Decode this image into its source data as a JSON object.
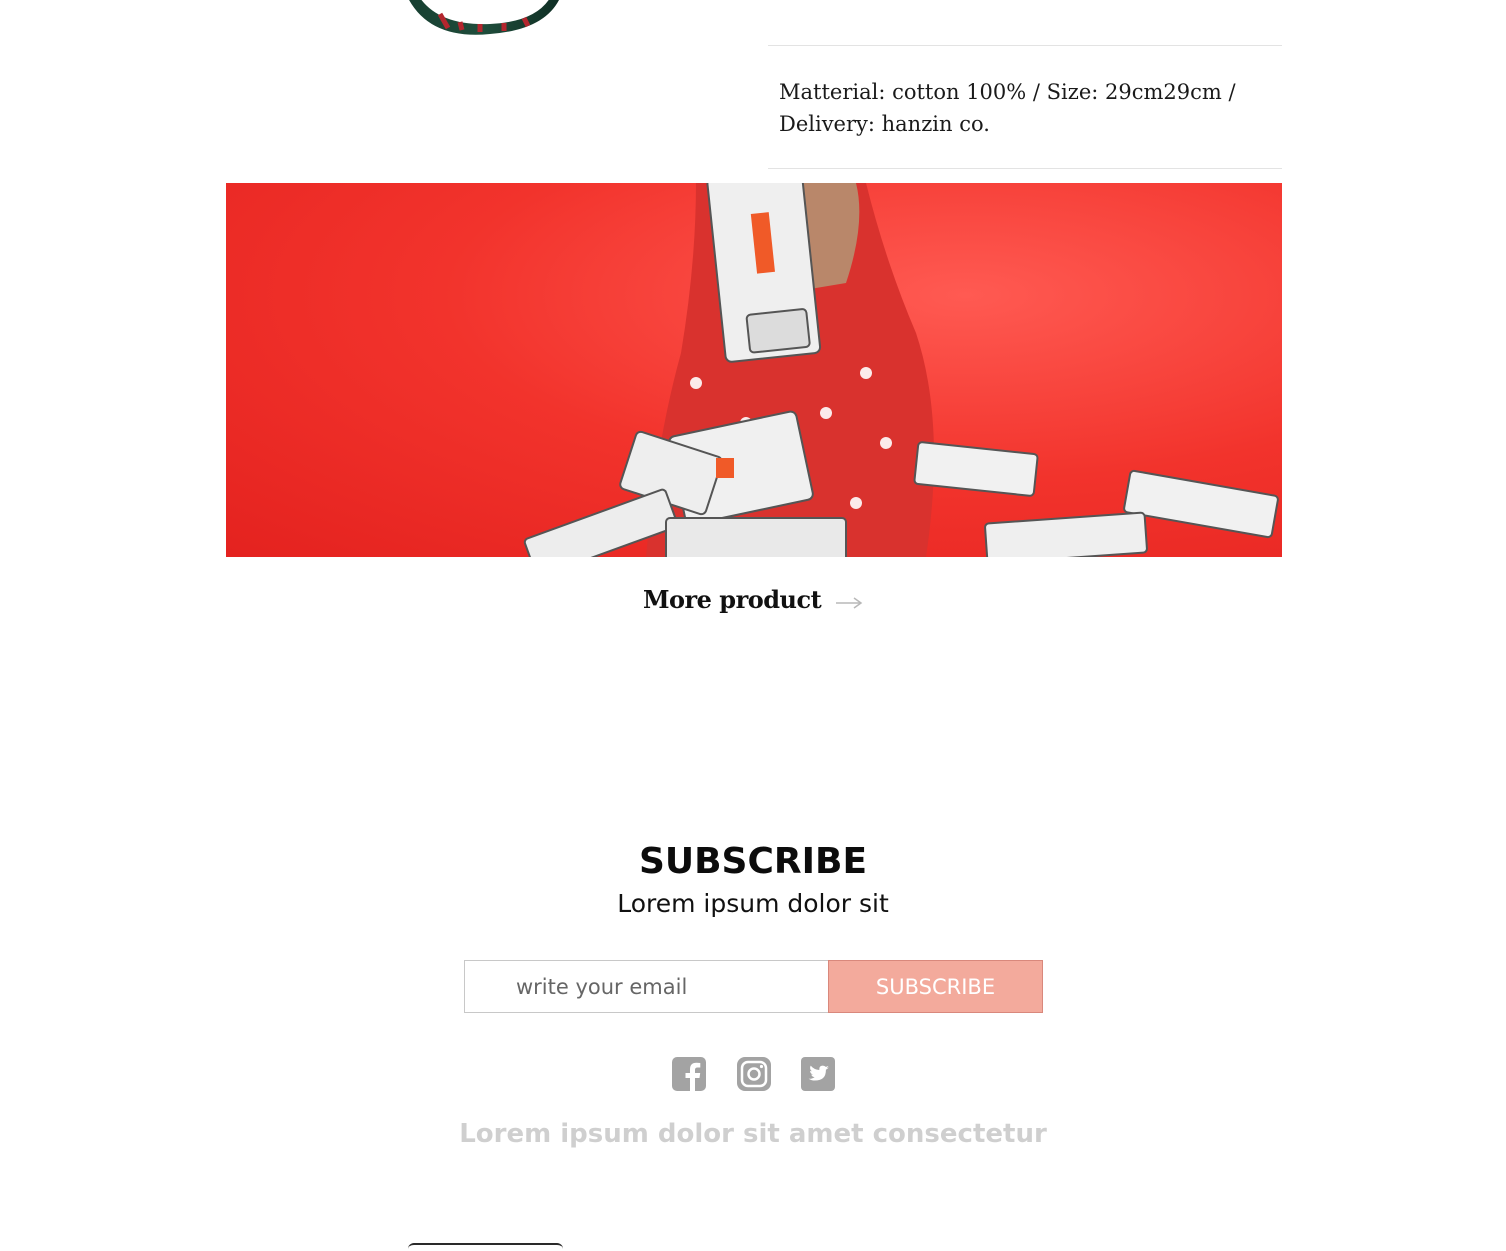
{
  "product": {
    "details": "Matterial: cotton 100% / Size: 29cm29cm / Delivery: hanzin co."
  },
  "more_product": {
    "label": "More product",
    "icon": "arrow-right-icon"
  },
  "subscribe": {
    "title": "SUBSCRIBE",
    "subtitle": "Lorem ipsum dolor sit",
    "email_placeholder": "write your email",
    "button_label": "SUBSCRIBE"
  },
  "social": [
    {
      "icon": "facebook-icon"
    },
    {
      "icon": "instagram-icon"
    },
    {
      "icon": "twitter-icon"
    }
  ],
  "footer": {
    "text": "Lorem ipsum dolor sit amet consectetur"
  },
  "colors": {
    "accent": "#f3aa9c",
    "banner_red": "#f2332c",
    "muted_text": "#cfcfcf",
    "icon_gray": "#9a9a9a"
  }
}
